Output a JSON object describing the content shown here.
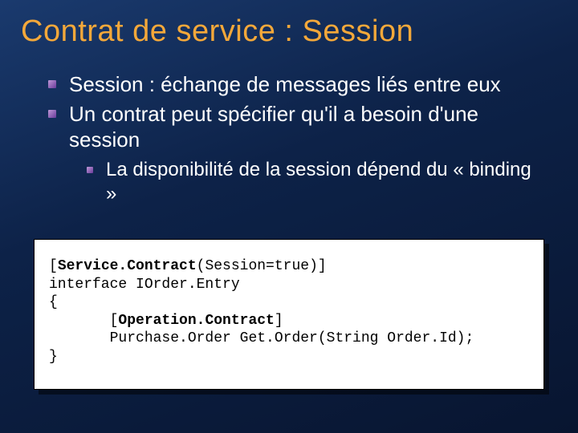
{
  "title": "Contrat de service : Session",
  "bullets": {
    "b1": "Session : échange de messages liés entre eux",
    "b2": "Un contrat peut spécifier qu'il a besoin d'une session",
    "sub1": "La disponibilité de la session dépend du « binding »"
  },
  "code": {
    "l1a": "[",
    "l1b": "Service.Contract",
    "l1c": "(Session=true)]",
    "l2": "interface IOrder.Entry",
    "l3": "{",
    "l4a": "       [",
    "l4b": "Operation.Contract",
    "l4c": "]",
    "l5": "       Purchase.Order Get.Order(String Order.Id);",
    "l6": "}"
  }
}
